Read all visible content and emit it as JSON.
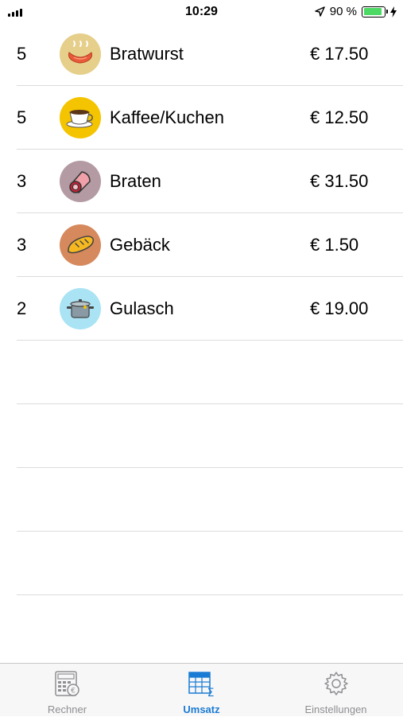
{
  "status_bar": {
    "time": "10:29",
    "battery_percent": "90 %",
    "battery_level": 0.9
  },
  "items": [
    {
      "qty": "5",
      "name": "Bratwurst",
      "price": "€ 17.50",
      "icon": "sausage-icon",
      "bg": "#e6cf8a"
    },
    {
      "qty": "5",
      "name": "Kaffee/Kuchen",
      "price": "€ 12.50",
      "icon": "coffee-cup-icon",
      "bg": "#f5c400"
    },
    {
      "qty": "3",
      "name": "Braten",
      "price": "€ 31.50",
      "icon": "roast-icon",
      "bg": "#b49aa3"
    },
    {
      "qty": "3",
      "name": "Gebäck",
      "price": "€ 1.50",
      "icon": "bread-icon",
      "bg": "#d6895c"
    },
    {
      "qty": "2",
      "name": "Gulasch",
      "price": "€ 19.00",
      "icon": "pot-icon",
      "bg": "#a9e3f4"
    }
  ],
  "tabs": [
    {
      "label": "Rechner",
      "icon": "calculator-icon",
      "active": false
    },
    {
      "label": "Umsatz",
      "icon": "sales-table-icon",
      "active": true
    },
    {
      "label": "Einstellungen",
      "icon": "gear-icon",
      "active": false
    }
  ],
  "colors": {
    "accent": "#1a7bd4",
    "inactive": "#8e8e93",
    "separator": "#dcdcdc"
  }
}
